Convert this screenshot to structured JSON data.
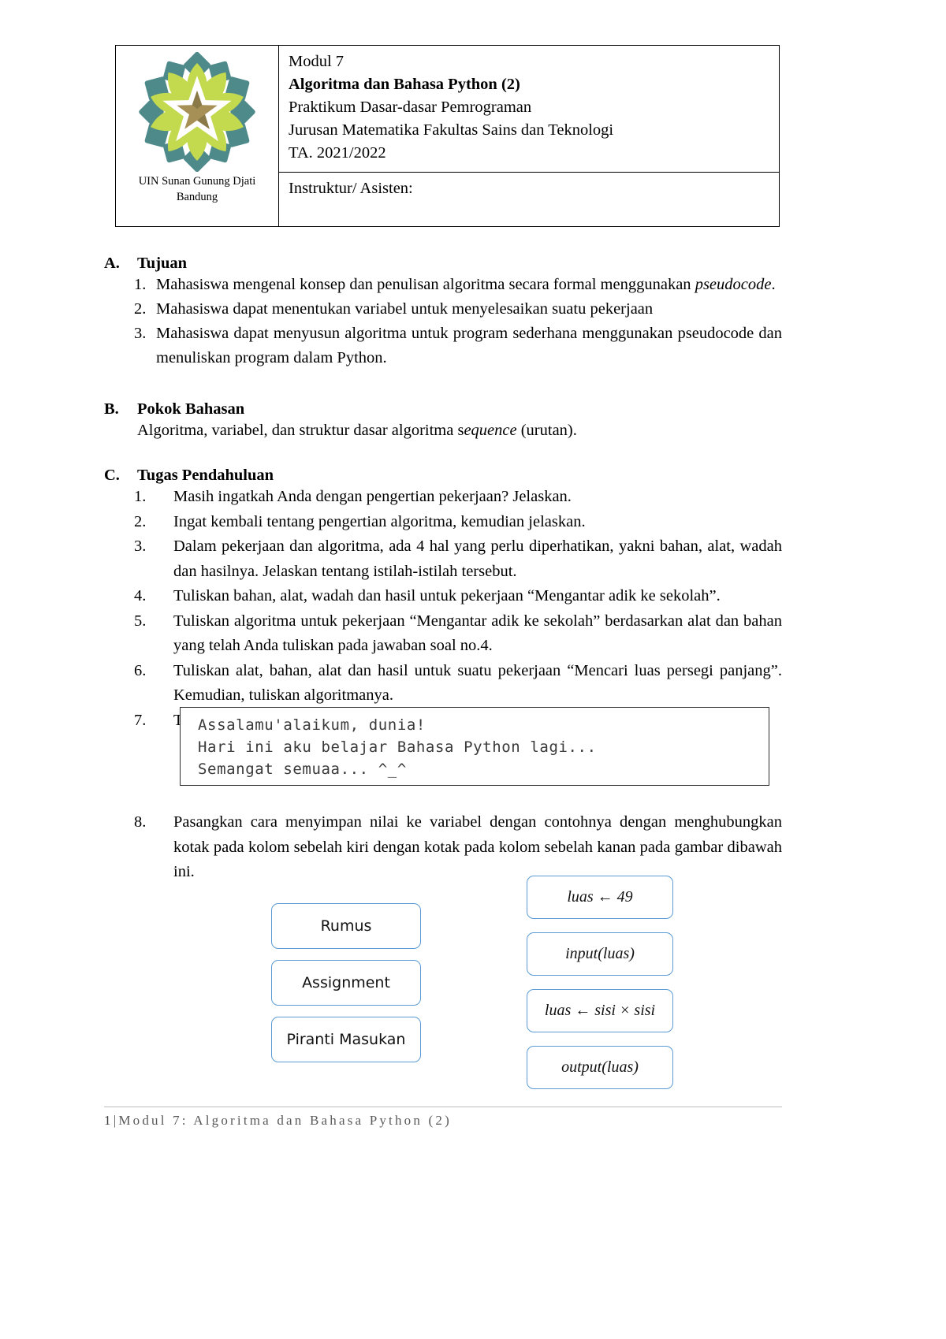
{
  "header": {
    "logo_caption_line1": "UIN Sunan Gunung Djati",
    "logo_caption_line2": "Bandung",
    "line1": "Modul 7",
    "line2": "Algoritma dan Bahasa Python (2)",
    "line3": "Praktikum Dasar-dasar Pemrograman",
    "line4": "Jurusan Matematika Fakultas Sains dan Teknologi",
    "line5": "TA. 2021/2022",
    "instructor_label": "Instruktur/ Asisten:",
    "logo_colors": {
      "teal": "#4f8a8b",
      "green": "#c3d94e",
      "gold": "#a79055",
      "gold_dark": "#8a7a48"
    }
  },
  "sections": {
    "a": {
      "letter": "A.",
      "title": "Tujuan",
      "items": [
        {
          "num": "1.",
          "parts": [
            {
              "text": "Mahasiswa mengenal konsep dan penulisan algoritma secara formal menggunakan ",
              "italic": false
            },
            {
              "text": "pseudocode",
              "italic": true
            },
            {
              "text": ".",
              "italic": false
            }
          ]
        },
        {
          "num": "2.",
          "parts": [
            {
              "text": "Mahasiswa dapat menentukan variabel untuk menyelesaikan suatu pekerjaan",
              "italic": false
            }
          ]
        },
        {
          "num": "3.",
          "parts": [
            {
              "text": "Mahasiswa dapat menyusun algoritma untuk program sederhana menggunakan pseudocode dan menuliskan program dalam Python.",
              "italic": false
            }
          ]
        }
      ]
    },
    "b": {
      "letter": "B.",
      "title": "Pokok Bahasan",
      "body_parts": [
        {
          "text": "Algoritma, variabel, dan struktur dasar algoritma s",
          "italic": false
        },
        {
          "text": "equence",
          "italic": true
        },
        {
          "text": " (urutan).",
          "italic": false
        }
      ]
    },
    "c": {
      "letter": "C.",
      "title": "Tugas Pendahuluan",
      "items": [
        {
          "num": "1.",
          "text": "Masih ingatkah Anda dengan pengertian pekerjaan? Jelaskan.",
          "justify": false
        },
        {
          "num": "2.",
          "text": "Ingat kembali tentang pengertian algoritma, kemudian jelaskan.",
          "justify": false
        },
        {
          "num": "3.",
          "text": "Dalam pekerjaan dan algoritma, ada 4 hal yang perlu diperhatikan, yakni bahan, alat, wadah dan hasilnya. Jelaskan tentang istilah-istilah tersebut.",
          "justify": false
        },
        {
          "num": "4.",
          "text": "Tuliskan bahan, alat, wadah dan hasil untuk pekerjaan “Mengantar adik ke sekolah”.",
          "justify": false
        },
        {
          "num": "5.",
          "text": "Tuliskan algoritma untuk pekerjaan “Mengantar adik ke sekolah” berdasarkan alat dan bahan yang telah Anda tuliskan pada jawaban soal no.4.",
          "justify": true
        },
        {
          "num": "6.",
          "text": "Tuliskan alat, bahan, alat dan hasil untuk suatu pekerjaan “Mencari luas persegi panjang”. Kemudian, tuliskan algoritmanya.",
          "justify": true
        },
        {
          "num": "7.",
          "text": "Tuliskan syntax untuk menampilkan hal berikut:",
          "justify": false
        },
        {
          "num": "8.",
          "text": "Pasangkan cara menyimpan nilai ke variabel dengan contohnya dengan menghubungkan kotak pada kolom sebelah kiri dengan kotak pada kolom sebelah kanan pada gambar dibawah ini.",
          "justify": true
        }
      ]
    }
  },
  "code_block": {
    "line1": "Assalamu'alaikum, dunia!",
    "line2": "Hari ini aku belajar Bahasa Python lagi...",
    "line3": "Semangat semuaa... ^_^"
  },
  "match_diagram": {
    "accent_color": "#5b9bd5",
    "left_boxes": [
      {
        "label": "Rumus"
      },
      {
        "label": "Assignment"
      },
      {
        "label": "Piranti Masukan"
      }
    ],
    "right_boxes": [
      {
        "label": "luas ← 49"
      },
      {
        "label": "input(luas)"
      },
      {
        "label": "luas ← sisi × sisi"
      },
      {
        "label": "output(luas)"
      }
    ]
  },
  "footer": {
    "page_number": "1",
    "separator": "|",
    "title": "Modul 7: Algoritma dan Bahasa Python (2)"
  }
}
